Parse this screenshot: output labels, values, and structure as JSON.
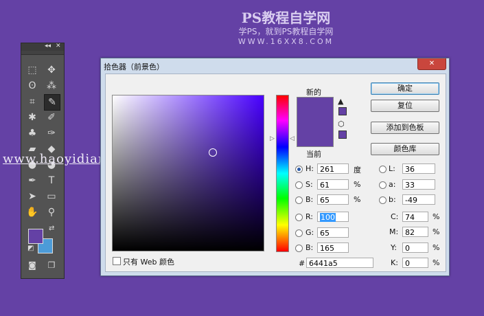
{
  "watermark": {
    "title": "PS教程自学网",
    "subtitle": "学PS，就到PS教程自学网",
    "site": "WWW.16XX8.COM",
    "url_overlay": "www.haoyidiansheji.com"
  },
  "toolbar": {
    "header_collapse": "◂◂",
    "header_close": "✕",
    "tools": [
      {
        "name": "marquee",
        "icon": "⬚"
      },
      {
        "name": "move",
        "icon": "✥"
      },
      {
        "name": "lasso",
        "icon": "ʘ"
      },
      {
        "name": "magic-wand",
        "icon": "⁂"
      },
      {
        "name": "crop",
        "icon": "⌗"
      },
      {
        "name": "eyedropper",
        "icon": "✎"
      },
      {
        "name": "healing",
        "icon": "✱"
      },
      {
        "name": "brush",
        "icon": "✐"
      },
      {
        "name": "stamp",
        "icon": "♣"
      },
      {
        "name": "history-brush",
        "icon": "✑"
      },
      {
        "name": "eraser",
        "icon": "▰"
      },
      {
        "name": "fill",
        "icon": "◆"
      },
      {
        "name": "blur",
        "icon": "●"
      },
      {
        "name": "dodge",
        "icon": "◕"
      },
      {
        "name": "pen",
        "icon": "✒"
      },
      {
        "name": "type",
        "icon": "T"
      },
      {
        "name": "path-select",
        "icon": "➤"
      },
      {
        "name": "shape",
        "icon": "▭"
      },
      {
        "name": "hand",
        "icon": "✋"
      },
      {
        "name": "zoom",
        "icon": "⚲"
      }
    ],
    "foreground_color": "#6441a5",
    "background_color": "#4c9bd8"
  },
  "dialog": {
    "title": "拾色器（前景色）",
    "close_glyph": "✕",
    "label_new": "新的",
    "label_current": "当前",
    "buttons": {
      "ok": "确定",
      "reset": "复位",
      "add_swatch": "添加到色板",
      "libraries": "颜色库"
    },
    "hsb": [
      {
        "label": "H:",
        "value": "261",
        "unit": "度",
        "selected": true
      },
      {
        "label": "S:",
        "value": "61",
        "unit": "%",
        "selected": false
      },
      {
        "label": "B:",
        "value": "65",
        "unit": "%",
        "selected": false
      }
    ],
    "rgb": [
      {
        "label": "R:",
        "value": "100"
      },
      {
        "label": "G:",
        "value": "65"
      },
      {
        "label": "B:",
        "value": "165"
      }
    ],
    "lab": [
      {
        "label": "L:",
        "value": "36"
      },
      {
        "label": "a:",
        "value": "33"
      },
      {
        "label": "b:",
        "value": "-49"
      }
    ],
    "cmyk": [
      {
        "label": "C:",
        "value": "74",
        "unit": "%"
      },
      {
        "label": "M:",
        "value": "82",
        "unit": "%"
      },
      {
        "label": "Y:",
        "value": "0",
        "unit": "%"
      },
      {
        "label": "K:",
        "value": "0",
        "unit": "%"
      }
    ],
    "hex_label": "#",
    "hex_value": "6441a5",
    "web_only_label": "只有 Web 颜色",
    "web_only_checked": false,
    "current_color": "#6441a5"
  }
}
